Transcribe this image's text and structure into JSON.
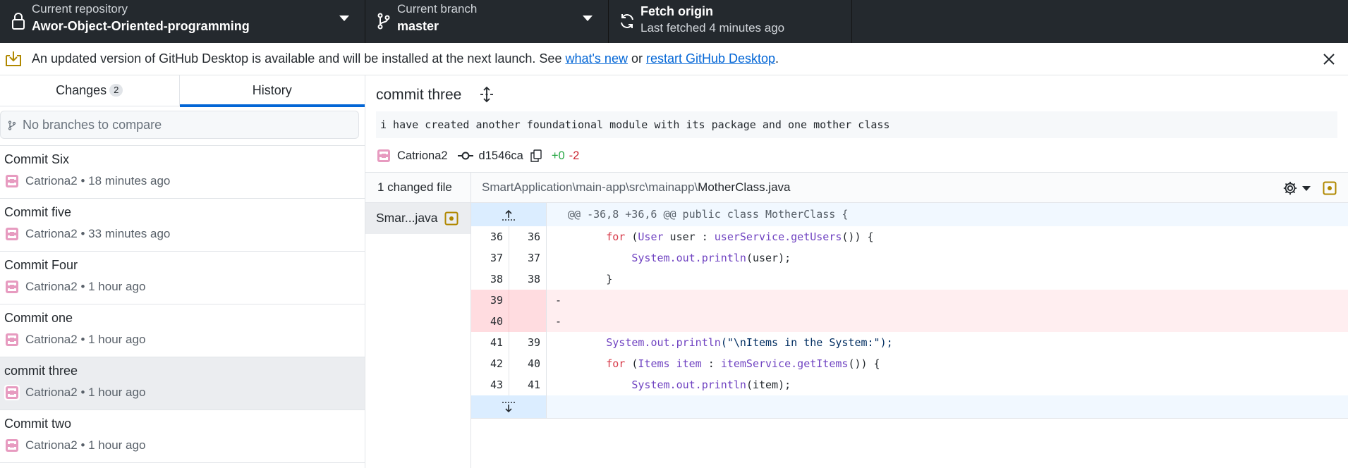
{
  "toolbar": {
    "repo_label": "Current repository",
    "repo_name": "Awor-Object-Oriented-programming",
    "branch_label": "Current branch",
    "branch_name": "master",
    "fetch_label": "Fetch origin",
    "fetch_sub": "Last fetched 4 minutes ago"
  },
  "banner": {
    "text_before": "An updated version of GitHub Desktop is available and will be installed at the next launch. See ",
    "link_whats_new": "what's new",
    "text_mid": " or ",
    "link_restart": "restart GitHub Desktop",
    "text_end": "."
  },
  "sidebar": {
    "tab_changes": "Changes",
    "changes_count": "2",
    "tab_history": "History",
    "compare_placeholder": "No branches to compare",
    "commits": [
      {
        "title": "Commit Six",
        "author": "Catriona2",
        "time": "18 minutes ago"
      },
      {
        "title": "Commit five",
        "author": "Catriona2",
        "time": "33 minutes ago"
      },
      {
        "title": "Commit Four",
        "author": "Catriona2",
        "time": "1 hour ago"
      },
      {
        "title": "Commit one",
        "author": "Catriona2",
        "time": "1 hour ago"
      },
      {
        "title": "commit three",
        "author": "Catriona2",
        "time": "1 hour ago",
        "selected": true
      },
      {
        "title": "Commit two",
        "author": "Catriona2",
        "time": "1 hour ago"
      }
    ]
  },
  "commit": {
    "title": "commit three",
    "description": "i have created another foundational module with its package and one mother class",
    "author": "Catriona2",
    "sha": "d1546ca",
    "additions": "+0",
    "deletions": "-2"
  },
  "files": {
    "changed_count": "1 changed file",
    "path_dir": "SmartApplication\\main-app\\src\\mainapp\\",
    "path_file": "MotherClass.java",
    "list": [
      {
        "name": "Smar...java",
        "status": "modified"
      }
    ]
  },
  "diff": {
    "hunk_header": "@@ -36,8 +36,6 @@ public class MotherClass {",
    "lines": [
      {
        "old": "36",
        "new": "36",
        "type": "ctx"
      },
      {
        "old": "37",
        "new": "37",
        "type": "ctx"
      },
      {
        "old": "38",
        "new": "38",
        "type": "ctx",
        "text": "        }"
      },
      {
        "old": "39",
        "new": "",
        "type": "del",
        "text": "-"
      },
      {
        "old": "40",
        "new": "",
        "type": "del",
        "text": "-"
      },
      {
        "old": "41",
        "new": "39",
        "type": "ctx"
      },
      {
        "old": "42",
        "new": "40",
        "type": "ctx"
      },
      {
        "old": "43",
        "new": "41",
        "type": "ctx"
      }
    ],
    "code_tokens": {
      "l36_kw": "for",
      "l36_a": " (",
      "l36_type": "User",
      "l36_b": " user : ",
      "l36_call": "userService.getUsers",
      "l36_c": "()) {",
      "l37_type": "System.out.println",
      "l37_a": "(user);",
      "l41_type": "System.out.println",
      "l41_str": "(\"\\nItems in the System:\");",
      "l42_kw": "for",
      "l42_a": " (",
      "l42_type": "Items item",
      "l42_b": " : ",
      "l42_call": "itemService.getItems",
      "l42_c": "()) {",
      "l43_type": "System.out.println",
      "l43_a": "(item);"
    }
  },
  "colors": {
    "toolbar_bg": "#24292e",
    "accent": "#0366d6",
    "addition": "#28a745",
    "deletion": "#cb2431",
    "modified": "#b08800"
  }
}
